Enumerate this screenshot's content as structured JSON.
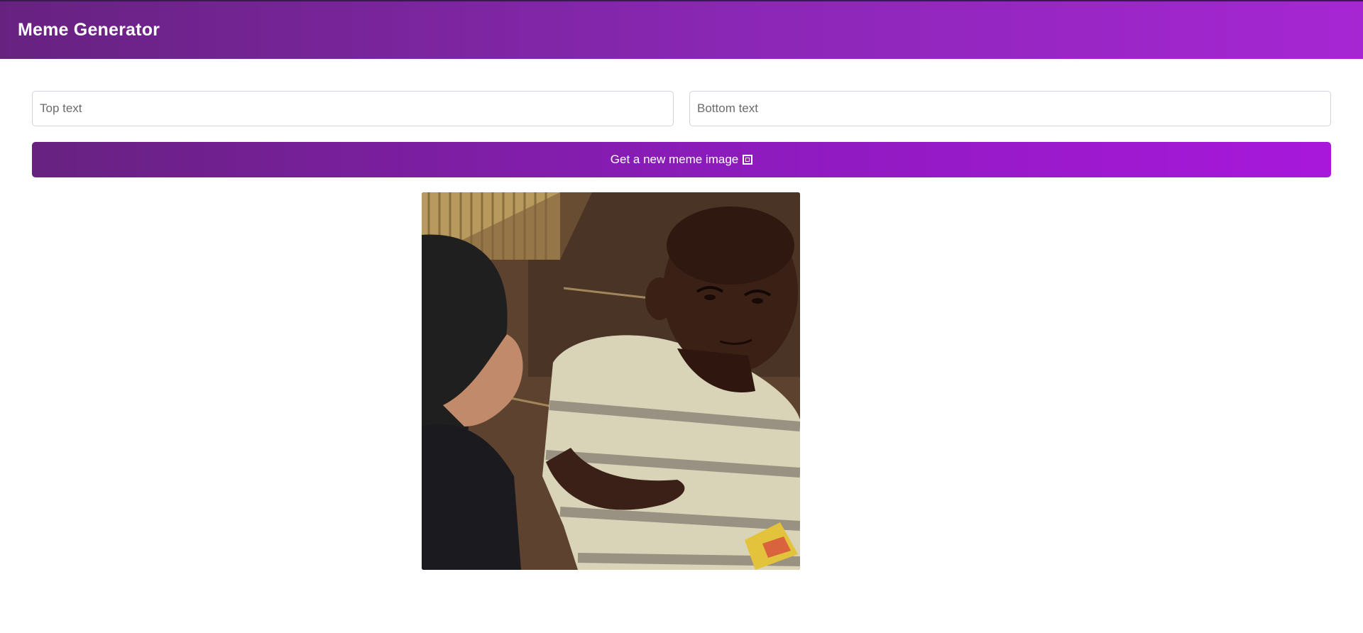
{
  "header": {
    "title": "Meme Generator"
  },
  "form": {
    "top_text": {
      "value": "",
      "placeholder": "Top text"
    },
    "bottom_text": {
      "value": "",
      "placeholder": "Bottom text"
    },
    "button_label": "Get a new meme image",
    "button_icon": "framed-picture-icon"
  },
  "meme": {
    "image_icon": "meme-photo"
  },
  "colors": {
    "header_gradient_start": "#672280",
    "header_gradient_end": "#a626d3",
    "button_gradient_start": "#672280",
    "button_gradient_end": "#a818db"
  }
}
